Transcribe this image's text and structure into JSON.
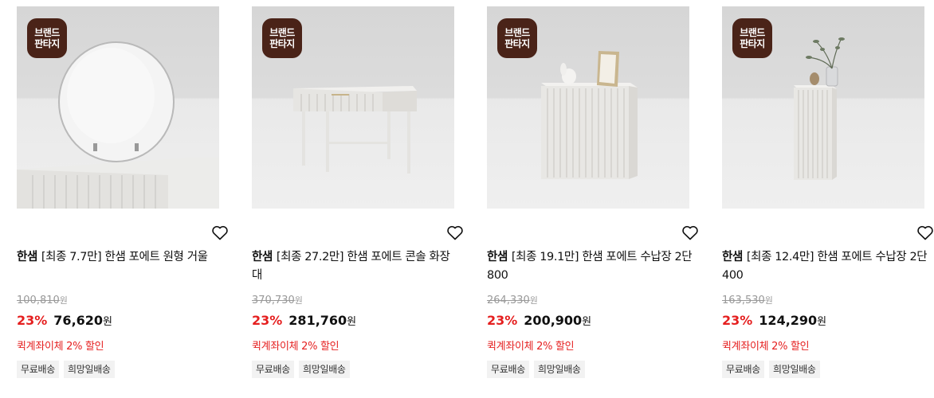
{
  "badge_line1": "브랜드",
  "badge_line2": "판타지",
  "products": [
    {
      "brand": "한샘",
      "title": "[최종 7.7만] 한샘 포에트 원형 거울",
      "original_price": "100,810",
      "currency": "원",
      "discount": "23%",
      "price": "76,620",
      "promo": "퀵계좌이체 2% 할인",
      "tags": [
        "무료배송",
        "희망일배송"
      ],
      "image": "round-mirror-image"
    },
    {
      "brand": "한샘",
      "title": "[최종 27.2만] 한샘 포에트 콘솔 화장대",
      "original_price": "370,730",
      "currency": "원",
      "discount": "23%",
      "price": "281,760",
      "promo": "퀵계좌이체 2% 할인",
      "tags": [
        "무료배송",
        "희망일배송"
      ],
      "image": "console-table-image"
    },
    {
      "brand": "한샘",
      "title": "[최종 19.1만] 한샘 포에트 수납장 2단 800",
      "original_price": "264,330",
      "currency": "원",
      "discount": "23%",
      "price": "200,900",
      "promo": "퀵계좌이체 2% 할인",
      "tags": [
        "무료배송",
        "희망일배송"
      ],
      "image": "wide-cabinet-image"
    },
    {
      "brand": "한샘",
      "title": "[최종 12.4만] 한샘 포에트 수납장 2단 400",
      "original_price": "163,530",
      "currency": "원",
      "discount": "23%",
      "price": "124,290",
      "promo": "퀵계좌이체 2% 할인",
      "tags": [
        "무료배송",
        "희망일배송"
      ],
      "image": "narrow-cabinet-image"
    }
  ],
  "colors": {
    "discount": "#e51f1f",
    "badge": "#4a2318",
    "tag_bg": "#f2f2f2"
  },
  "icons": {
    "wishlist": "heart-icon"
  }
}
